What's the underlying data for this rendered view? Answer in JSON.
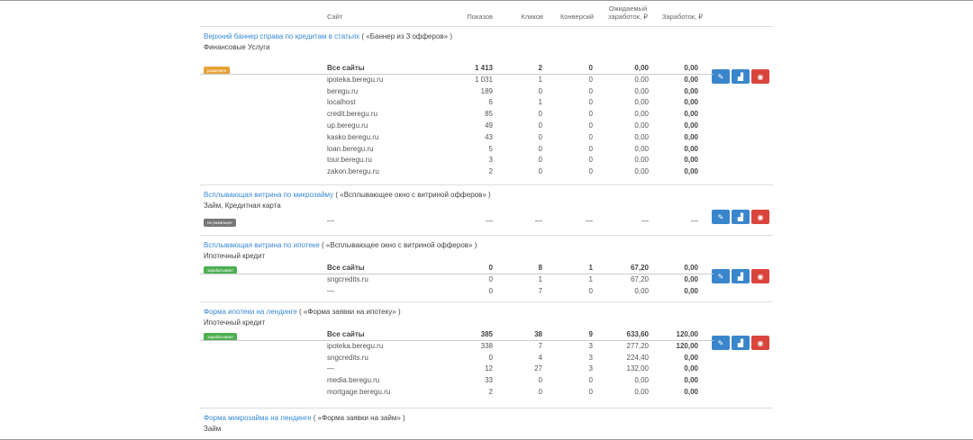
{
  "header": {
    "site": "Сайт",
    "shows": "Показов",
    "clicks": "Кликов",
    "conv": "Конверсий",
    "expected_line1": "Ожидаемый",
    "expected_line2": "заработок, ₽",
    "earned": "Заработок, ₽"
  },
  "sections": [
    {
      "title": "Верхний баннер справа по кредитам в статьях",
      "subtitle": "( «Баннер из 3 офферов» )",
      "category": "Финансовые Услуги",
      "badge": "размещен",
      "badge_color": "#e5a234",
      "rows": [
        {
          "site": "Все сайты",
          "shows": "1 413",
          "clicks": "2",
          "conv": "0",
          "expected": "0,00",
          "earned": "0,00"
        },
        {
          "site": "ipoteka.beregu.ru",
          "shows": "1 031",
          "clicks": "1",
          "conv": "0",
          "expected": "0,00",
          "earned": "0,00"
        },
        {
          "site": "beregu.ru",
          "shows": "189",
          "clicks": "0",
          "conv": "0",
          "expected": "0,00",
          "earned": "0,00"
        },
        {
          "site": "localhost",
          "shows": "6",
          "clicks": "1",
          "conv": "0",
          "expected": "0,00",
          "earned": "0,00"
        },
        {
          "site": "credit.beregu.ru",
          "shows": "85",
          "clicks": "0",
          "conv": "0",
          "expected": "0,00",
          "earned": "0,00"
        },
        {
          "site": "up.beregu.ru",
          "shows": "49",
          "clicks": "0",
          "conv": "0",
          "expected": "0,00",
          "earned": "0,00"
        },
        {
          "site": "kasko.beregu.ru",
          "shows": "43",
          "clicks": "0",
          "conv": "0",
          "expected": "0,00",
          "earned": "0,00"
        },
        {
          "site": "loan.beregu.ru",
          "shows": "5",
          "clicks": "0",
          "conv": "0",
          "expected": "0,00",
          "earned": "0,00"
        },
        {
          "site": "tour.beregu.ru",
          "shows": "3",
          "clicks": "0",
          "conv": "0",
          "expected": "0,00",
          "earned": "0,00"
        },
        {
          "site": "zakon.beregu.ru",
          "shows": "2",
          "clicks": "0",
          "conv": "0",
          "expected": "0,00",
          "earned": "0,00"
        }
      ]
    },
    {
      "title": "Всплывающая витрина по микрозайму",
      "subtitle": "( «Всплывающее окно с витриной офферов» )",
      "category": "Займ, Кредитная карта",
      "badge": "не размещен",
      "badge_color": "#777777",
      "dash": "—"
    },
    {
      "title": "Всплывающая витрина по ипотеке",
      "subtitle": "( «Всплывающее окно с витриной офферов» )",
      "category": "Ипотечный кредит",
      "badge": "зарабатывает",
      "badge_color": "#4caf50",
      "rows": [
        {
          "site": "Все сайты",
          "shows": "0",
          "clicks": "8",
          "conv": "1",
          "expected": "67,20",
          "earned": "0,00"
        },
        {
          "site": "sngcredits.ru",
          "shows": "0",
          "clicks": "1",
          "conv": "1",
          "expected": "67,20",
          "earned": "0,00"
        },
        {
          "site": "—",
          "shows": "0",
          "clicks": "7",
          "conv": "0",
          "expected": "0,00",
          "earned": "0,00"
        }
      ]
    },
    {
      "title": "Форма ипотеки на лендинге",
      "subtitle": "( «Форма заявки на ипотеку» )",
      "category": "Ипотечный кредит",
      "badge": "зарабатывает",
      "badge_color": "#4caf50",
      "rows": [
        {
          "site": "Все сайты",
          "shows": "385",
          "clicks": "38",
          "conv": "9",
          "expected": "633,60",
          "earned": "120,00"
        },
        {
          "site": "ipoteka.beregu.ru",
          "shows": "338",
          "clicks": "7",
          "conv": "3",
          "expected": "277,20",
          "earned": "120,00"
        },
        {
          "site": "sngcredits.ru",
          "shows": "0",
          "clicks": "4",
          "conv": "3",
          "expected": "224,40",
          "earned": "0,00"
        },
        {
          "site": "—",
          "shows": "12",
          "clicks": "27",
          "conv": "3",
          "expected": "132,00",
          "earned": "0,00"
        },
        {
          "site": "media.beregu.ru",
          "shows": "33",
          "clicks": "0",
          "conv": "0",
          "expected": "0,00",
          "earned": "0,00"
        },
        {
          "site": "mortgage.beregu.ru",
          "shows": "2",
          "clicks": "0",
          "conv": "0",
          "expected": "0,00",
          "earned": "0,00"
        }
      ]
    },
    {
      "title": "Форма микрозайма на лендинге",
      "subtitle": "( «Форма заявки на займ» )",
      "category": "Займ"
    }
  ],
  "icons": {
    "edit": "pencil-icon",
    "stats": "bar-chart-icon",
    "view": "eye-icon"
  },
  "colors": {
    "link": "#3a8ad4",
    "btn_blue": "#3a86cc",
    "btn_red": "#d9453c"
  }
}
